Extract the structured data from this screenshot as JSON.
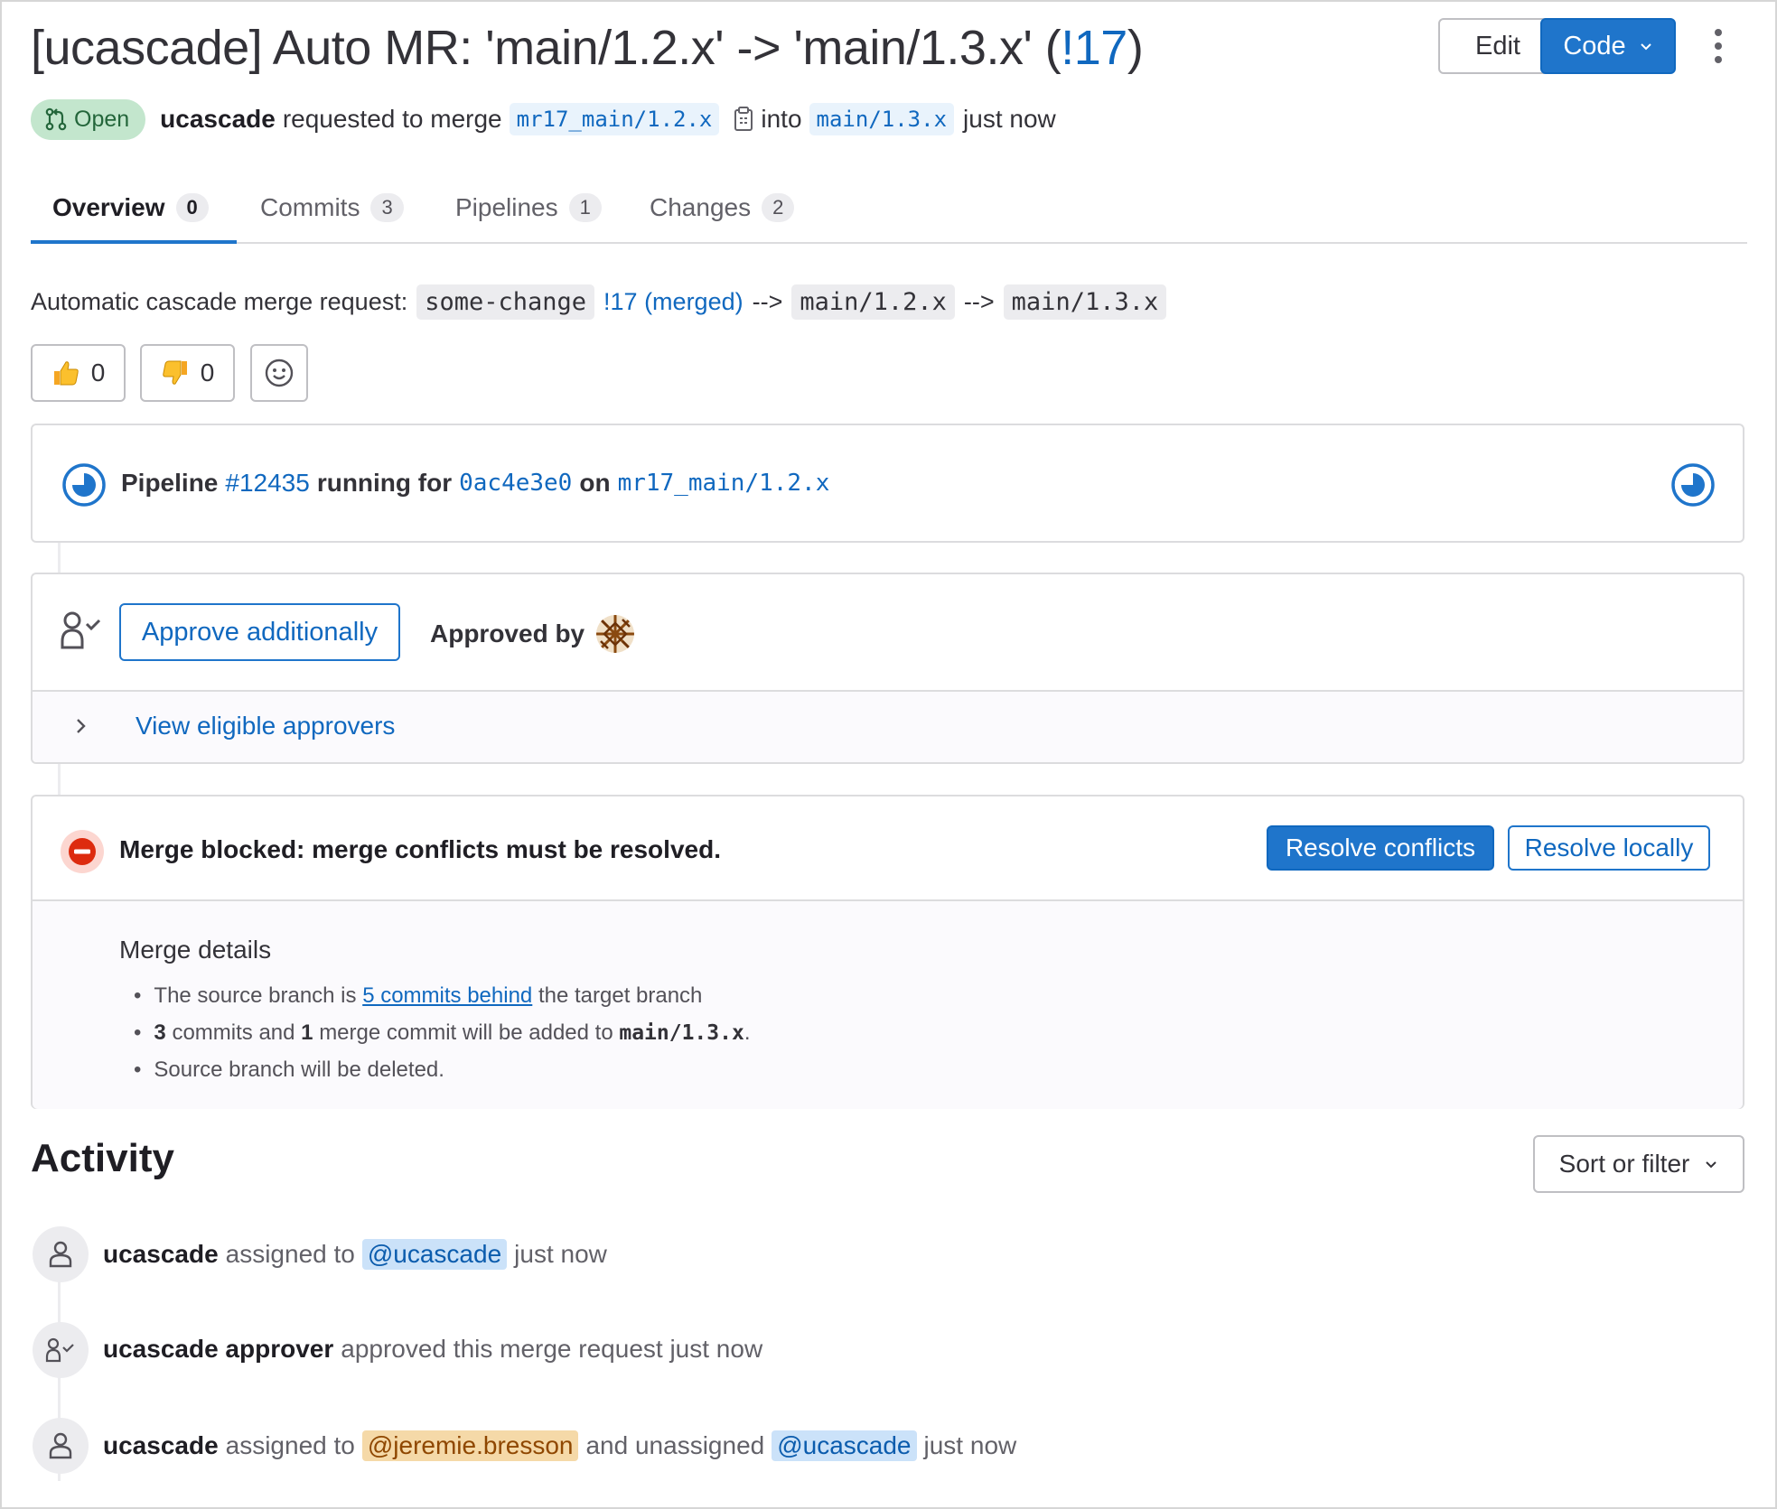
{
  "header": {
    "title_prefix": "[ucascade] Auto MR: 'main/1.2.x' -> 'main/1.3.x' (",
    "title_ref": "!17",
    "title_suffix": ")",
    "edit_label": "Edit",
    "code_label": "Code"
  },
  "meta": {
    "status": "Open",
    "author": "ucascade",
    "requested_text": "requested to merge",
    "source_branch": "mr17_main/1.2.x",
    "into_text": "into",
    "target_branch": "main/1.3.x",
    "time": "just now"
  },
  "tabs": [
    {
      "label": "Overview",
      "count": "0"
    },
    {
      "label": "Commits",
      "count": "3"
    },
    {
      "label": "Pipelines",
      "count": "1"
    },
    {
      "label": "Changes",
      "count": "2"
    }
  ],
  "description": {
    "prefix": "Automatic cascade merge request:",
    "code1": "some-change",
    "link": "!17 (merged)",
    "arrow1": "-->",
    "code2": "main/1.2.x",
    "arrow2": "-->",
    "code3": "main/1.3.x"
  },
  "reactions": {
    "thumbs_up_count": "0",
    "thumbs_down_count": "0"
  },
  "pipeline": {
    "label": "Pipeline",
    "id": "#12435",
    "running_for": "running for",
    "sha": "0ac4e3e0",
    "on": "on",
    "branch": "mr17_main/1.2.x"
  },
  "approvals": {
    "approve_button": "Approve additionally",
    "approved_by": "Approved by",
    "view_eligible": "View eligible approvers"
  },
  "merge": {
    "blocked_text": "Merge blocked: merge conflicts must be resolved.",
    "resolve_conflicts": "Resolve conflicts",
    "resolve_locally": "Resolve locally",
    "details_title": "Merge details",
    "line1_prefix": "The source branch is",
    "line1_link": "5 commits behind",
    "line1_suffix": "the target branch",
    "line2_count1": "3",
    "line2_mid1": "commits and",
    "line2_count2": "1",
    "line2_mid2": "merge commit will be added to",
    "line2_branch": "main/1.3.x",
    "line2_end": ".",
    "line3": "Source branch will be deleted."
  },
  "activity": {
    "title": "Activity",
    "sort_label": "Sort or filter",
    "items": [
      {
        "actor": "ucascade",
        "text1": "assigned to",
        "mention": "@ucascade",
        "time": "just now"
      },
      {
        "actor": "ucascade approver",
        "text1": "approved this merge request just now"
      },
      {
        "actor": "ucascade",
        "text1": "assigned to",
        "mention": "@jeremie.bresson",
        "text2": "and unassigned",
        "mention2": "@ucascade",
        "time": "just now"
      }
    ]
  },
  "colors": {
    "primary": "#1f75cb",
    "link": "#1068bf",
    "success_bg": "#c3e6cd",
    "danger": "#dd2b0e"
  }
}
